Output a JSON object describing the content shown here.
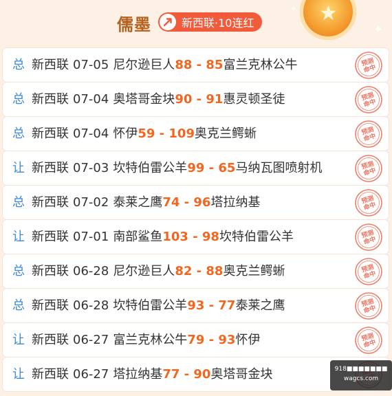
{
  "header": {
    "author": "儒墨",
    "badge_text": "新西联·10连红"
  },
  "rows": [
    {
      "type": "总",
      "league": "新西联",
      "date": "07-05",
      "home": "尼尔逊巨人",
      "home_score": "88",
      "away_score": "85",
      "away": "富兰克林公牛",
      "stamp": "预测命中"
    },
    {
      "type": "总",
      "league": "新西联",
      "date": "07-04",
      "home": "奥塔哥金块",
      "home_score": "90",
      "away_score": "91",
      "away": "惠灵顿圣徒",
      "stamp": "预测命中"
    },
    {
      "type": "总",
      "league": "新西联",
      "date": "07-04",
      "home": "怀伊",
      "home_score": "59",
      "away_score": "109",
      "away": "奥克兰鳄蜥",
      "stamp": "预测命中"
    },
    {
      "type": "让",
      "league": "新西联",
      "date": "07-03",
      "home": "坎特伯雷公羊",
      "home_score": "99",
      "away_score": "65",
      "away": "马纳瓦图喷射机",
      "stamp": "预测命中"
    },
    {
      "type": "总",
      "league": "新西联",
      "date": "07-02",
      "home": "泰莱之鹰",
      "home_score": "74",
      "away_score": "96",
      "away": "塔拉纳基",
      "stamp": "预测命中"
    },
    {
      "type": "让",
      "league": "新西联",
      "date": "07-01",
      "home": "南部鲨鱼",
      "home_score": "103",
      "away_score": "98",
      "away": "坎特伯雷公羊",
      "stamp": "预测命中"
    },
    {
      "type": "总",
      "league": "新西联",
      "date": "06-28",
      "home": "尼尔逊巨人",
      "home_score": "82",
      "away_score": "88",
      "away": "奥克兰鳄蜥",
      "stamp": "预测命中"
    },
    {
      "type": "总",
      "league": "新西联",
      "date": "06-28",
      "home": "坎特伯雷公羊",
      "home_score": "93",
      "away_score": "77",
      "away": "泰莱之鹰",
      "stamp": "预测命中"
    },
    {
      "type": "让",
      "league": "新西联",
      "date": "06-27",
      "home": "富兰克林公牛",
      "home_score": "79",
      "away_score": "93",
      "away": "怀伊",
      "stamp": "预测命中"
    },
    {
      "type": "让",
      "league": "新西联",
      "date": "06-27",
      "home": "塔拉纳基",
      "home_score": "77",
      "away_score": "90",
      "away": "奥塔哥金块",
      "stamp": "预测命中"
    }
  ],
  "watermark": {
    "line1": "918■■■■■■■",
    "line2": "wagcs.com"
  },
  "colors": {
    "accent": "#f2671f",
    "type_blue": "#3e8ad8",
    "badge_red": "#f15a3a",
    "author_brown": "#b4621f",
    "stamp_red": "#e8533a"
  }
}
